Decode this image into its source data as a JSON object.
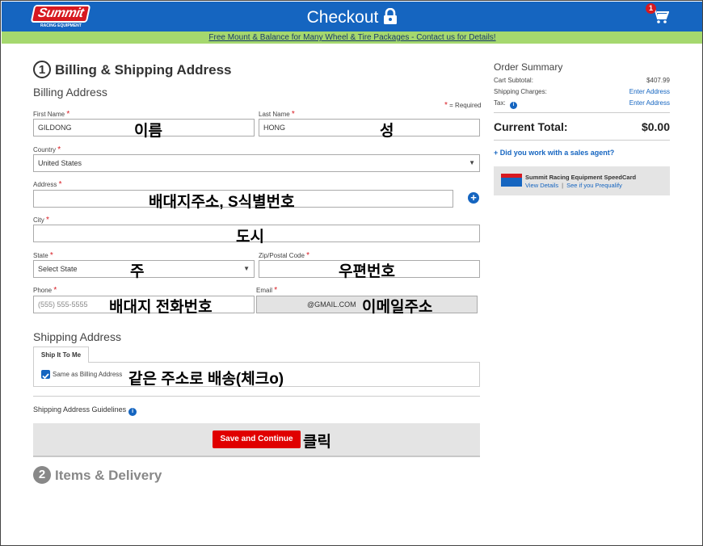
{
  "header": {
    "logo_text": "Summit",
    "logo_subtext": "RACING EQUIPMENT",
    "title": "Checkout",
    "cart_count": "1",
    "colors": {
      "header_bg": "#1565c0",
      "promo_bg": "#a5d86e",
      "accent_red": "#d71920"
    }
  },
  "promo": {
    "text": "Free Mount & Balance for Many Wheel & Tire Packages - Contact us for Details!"
  },
  "billing": {
    "step_number": "1",
    "step_title": "Billing & Shipping Address",
    "section_title": "Billing Address",
    "required_note": "= Required",
    "required_mark": "*",
    "first_name": {
      "label": "First Name",
      "value": "GILDONG",
      "annotation": "이름"
    },
    "last_name": {
      "label": "Last Name",
      "value": "HONG",
      "annotation": "성"
    },
    "country": {
      "label": "Country",
      "value": "United States"
    },
    "address": {
      "label": "Address",
      "value": "",
      "annotation": "배대지주소, S식별번호"
    },
    "city": {
      "label": "City",
      "value": "",
      "annotation": "도시"
    },
    "state": {
      "label": "State",
      "value": "Select State",
      "annotation": "주"
    },
    "zip": {
      "label": "Zip/Postal Code",
      "value": "",
      "annotation": "우편번호"
    },
    "phone": {
      "label": "Phone",
      "placeholder": "(555) 555-5555",
      "annotation": "배대지 전화번호"
    },
    "email": {
      "label": "Email",
      "value": "@GMAIL.COM",
      "annotation": "이메일주소"
    }
  },
  "shipping": {
    "section_title": "Shipping Address",
    "tab_label": "Ship It To Me",
    "same_as_billing_label": "Same as Billing Address",
    "same_as_billing_checked": true,
    "checkbox_annotation": "같은 주소로 배송(체크o)",
    "guidelines_label": "Shipping Address Guidelines"
  },
  "actions": {
    "save_label": "Save and Continue",
    "save_annotation": "클릭"
  },
  "step2": {
    "step_number": "2",
    "step_title": "Items & Delivery"
  },
  "order_summary": {
    "title": "Order Summary",
    "cart_subtotal_label": "Cart Subtotal:",
    "cart_subtotal_value": "$407.99",
    "shipping_label": "Shipping Charges:",
    "shipping_value": "Enter Address",
    "tax_label": "Tax:",
    "tax_value": "Enter Address",
    "total_label": "Current Total:",
    "total_value": "$0.00",
    "sales_agent_link": "+ Did you work with a sales agent?",
    "speedcard_title": "Summit Racing Equipment SpeedCard",
    "speedcard_view": "View Details",
    "speedcard_separator": "|",
    "speedcard_prequalify": "See if you Prequalify"
  }
}
